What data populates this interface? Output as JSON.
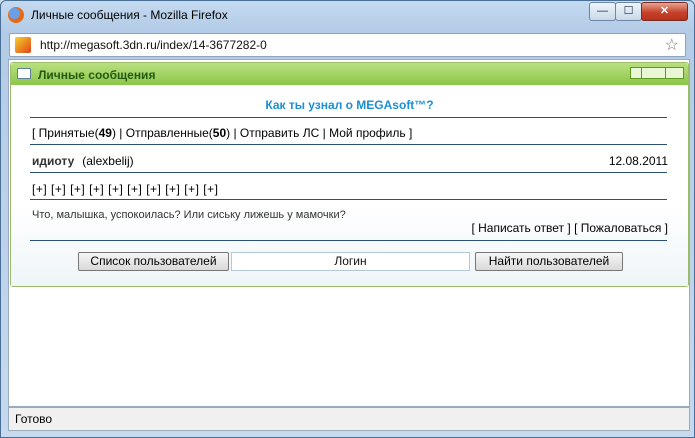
{
  "window": {
    "title": "Личные сообщения - Mozilla Firefox",
    "min_symbol": "—",
    "max_symbol": "☐",
    "close_symbol": "✕"
  },
  "address": {
    "url": "http://megasoft.3dn.ru/index/14-3677282-0",
    "star_symbol": "☆"
  },
  "panel": {
    "title": "Личные сообщения",
    "header_link": "Как ты узнал о MEGAsoft™?"
  },
  "nav": {
    "open": "[ ",
    "inbox_label": "Принятые",
    "inbox_count_open": "(",
    "inbox_count": "49",
    "inbox_count_close": ")",
    "sep1": " | ",
    "sent_label": "Отправленные",
    "sent_count_open": "(",
    "sent_count": "50",
    "sent_count_close": ")",
    "sep2": " | ",
    "send_label": "Отправить ЛС",
    "sep3": " | ",
    "profile_label": "Мой профиль",
    "close": " ]"
  },
  "message": {
    "sender_label": "идиоту",
    "sender_name": "(alexbelij)",
    "date": "12.08.2011",
    "plus_items": [
      "[+]",
      "[+]",
      "[+]",
      "[+]",
      "[+]",
      "[+]",
      "[+]",
      "[+]",
      "[+]",
      "[+]"
    ],
    "text": "Что, малышка, успокоилась? Или сиську лижешь у мамочки?",
    "reply_label": "[ Написать ответ ]",
    "complain_label": "[ Пожаловаться ]"
  },
  "search": {
    "users_list_button": "Список пользователей",
    "login_field": "Логин",
    "find_button": "Найти пользователей"
  },
  "status": {
    "text": "Готово"
  },
  "icons": {
    "browser": "firefox-icon",
    "site": "site-favicon",
    "mail": "mail-icon"
  },
  "colors": {
    "header_green": "#8cc64a",
    "link_blue": "#1a8fd6",
    "close_red": "#c5432a"
  }
}
